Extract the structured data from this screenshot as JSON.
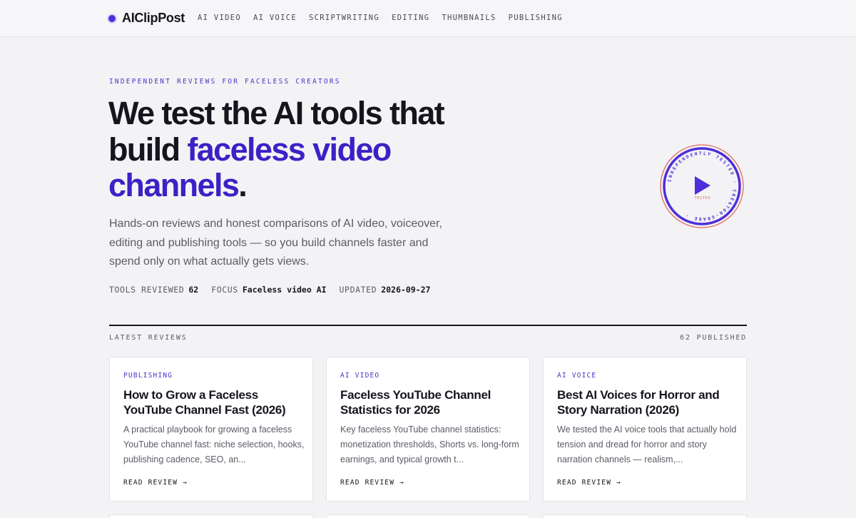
{
  "brand": {
    "name": "AIClipPost",
    "accent": "#4f2fd8"
  },
  "nav": [
    "AI VIDEO",
    "AI VOICE",
    "SCRIPTWRITING",
    "EDITING",
    "THUMBNAILS",
    "PUBLISHING"
  ],
  "hero": {
    "eyebrow": "INDEPENDENT REVIEWS FOR FACELESS CREATORS",
    "headline_pre": "We test the AI tools that build ",
    "headline_accent": "faceless video channels",
    "headline_post": ".",
    "lede": "Hands-on reviews and honest comparisons of AI video, voiceover, editing and publishing tools — so you build channels faster and spend only on what actually gets views.",
    "stats": [
      {
        "label": "TOOLS REVIEWED",
        "value": "62"
      },
      {
        "label": "FOCUS",
        "value": "Faceless video AI"
      },
      {
        "label": "UPDATED",
        "value": "2026-09-27"
      }
    ]
  },
  "badge": {
    "ring_text": "INDEPENDENTLY TESTED · CREATOR-GRADE ·",
    "center_label": "TESTED",
    "colors": {
      "ring": "#4f2fd8",
      "outer": "#e06a5a"
    }
  },
  "latest": {
    "title": "LATEST REVIEWS",
    "count": "62 PUBLISHED",
    "cards": [
      {
        "category": "PUBLISHING",
        "title": "How to Grow a Faceless YouTube Channel Fast (2026)",
        "description": "A practical playbook for growing a faceless YouTube channel fast: niche selection, hooks, publishing cadence, SEO, an...",
        "link": "READ REVIEW →"
      },
      {
        "category": "AI VIDEO",
        "title": "Faceless YouTube Channel Statistics for 2026",
        "description": "Key faceless YouTube channel statistics: monetization thresholds, Shorts vs. long-form earnings, and typical growth t...",
        "link": "READ REVIEW →"
      },
      {
        "category": "AI VOICE",
        "title": "Best AI Voices for Horror and Story Narration (2026)",
        "description": "We tested the AI voice tools that actually hold tension and dread for horror and story narration channels — realism,...",
        "link": "READ REVIEW →"
      }
    ]
  }
}
